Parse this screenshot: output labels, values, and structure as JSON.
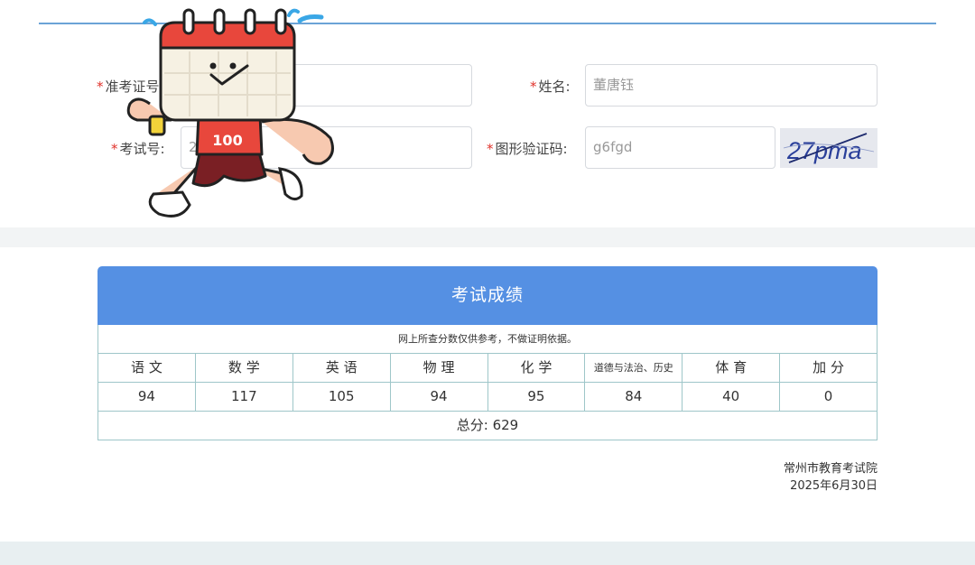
{
  "form": {
    "ticket_label": "准考证号",
    "ticket_value": "",
    "name_label": "姓名:",
    "name_value": "董唐钰",
    "exam_no_label": "考试号:",
    "exam_no_value": "27",
    "captcha_label": "图形验证码:",
    "captcha_value": "g6fgd",
    "captcha_image_text": "27pma",
    "required_mark": "*"
  },
  "results": {
    "title": "考试成绩",
    "notice": "网上所查分数仅供参考，不做证明依据。",
    "subjects": [
      "语 文",
      "数 学",
      "英 语",
      "物 理",
      "化 学",
      "道德与法治、历史",
      "体 育",
      "加 分"
    ],
    "scores": [
      "94",
      "117",
      "105",
      "94",
      "95",
      "84",
      "40",
      "0"
    ],
    "total": "总分:  629"
  },
  "footer": {
    "org": "常州市教育考试院",
    "date": "2025年6月30日"
  },
  "mascot": {
    "icon": "running-calendar-mascot-icon",
    "badge_text": "100"
  },
  "colors": {
    "header_blue": "#5590e3",
    "table_border": "#9ec6c9",
    "required_red": "#e0322b",
    "mascot_red": "#e8473c"
  }
}
